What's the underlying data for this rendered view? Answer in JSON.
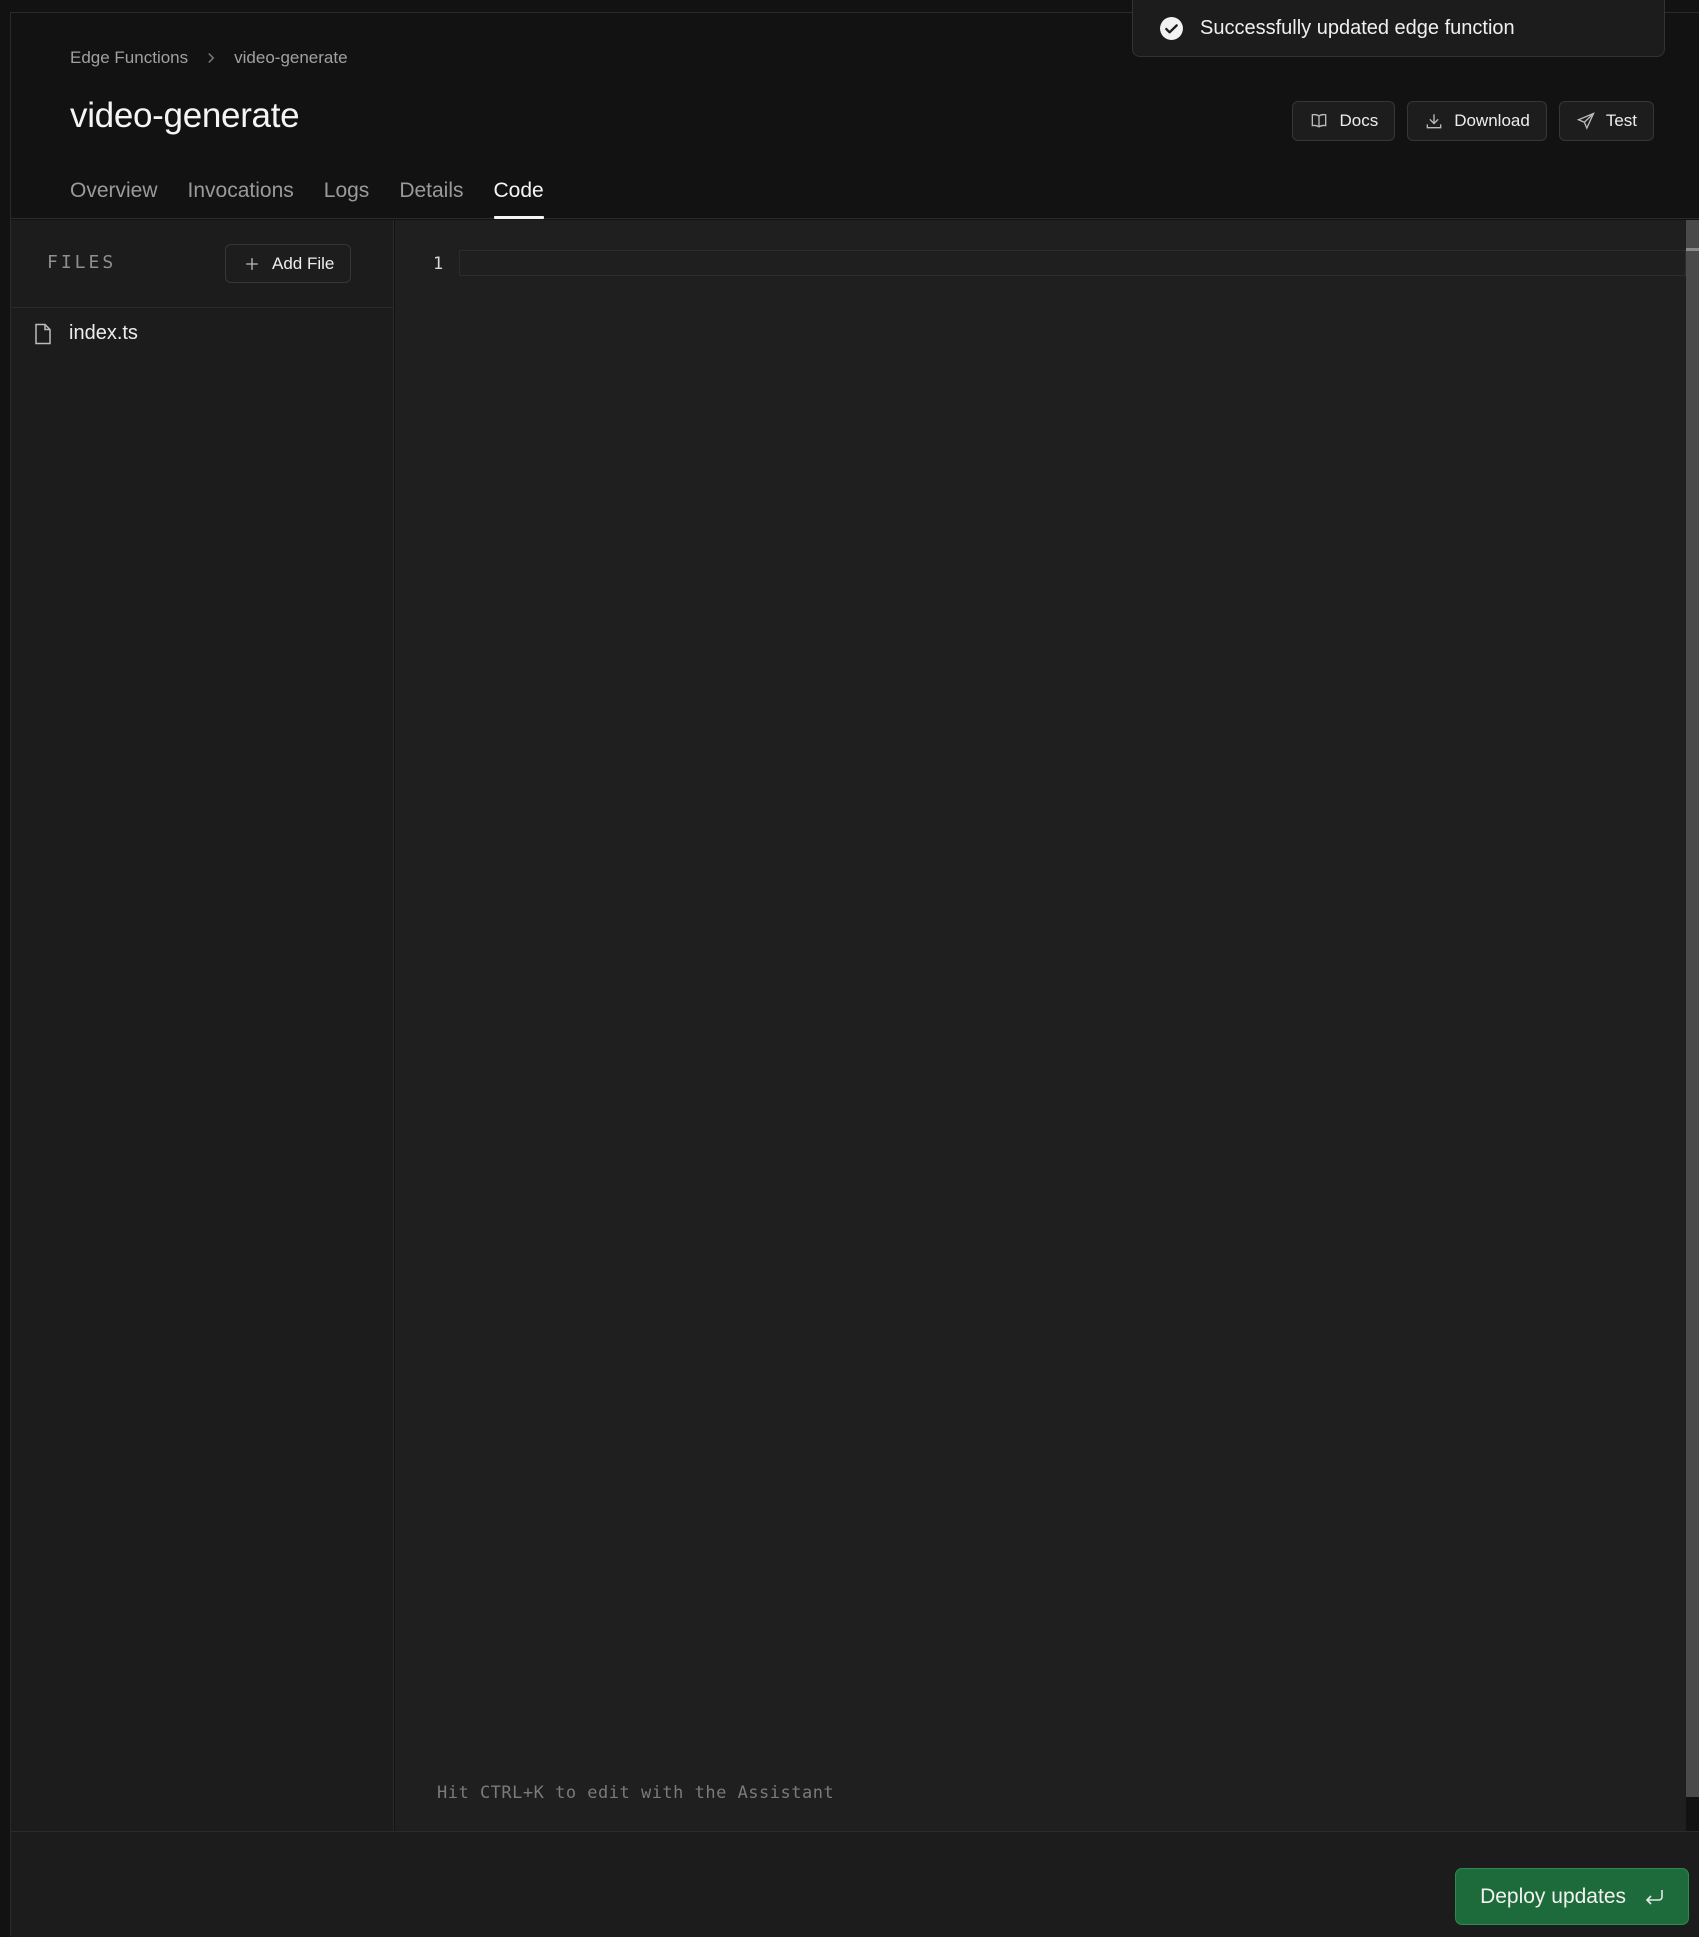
{
  "breadcrumb": {
    "root": "Edge Functions",
    "current": "video-generate"
  },
  "page": {
    "title": "video-generate"
  },
  "actions": {
    "docs": "Docs",
    "download": "Download",
    "test": "Test"
  },
  "tabs": [
    {
      "label": "Overview"
    },
    {
      "label": "Invocations"
    },
    {
      "label": "Logs"
    },
    {
      "label": "Details"
    },
    {
      "label": "Code",
      "active": true
    }
  ],
  "files": {
    "label": "FILES",
    "add_label": "Add File",
    "items": [
      {
        "name": "index.ts"
      }
    ]
  },
  "editor": {
    "line_numbers": [
      "1"
    ],
    "hint": "Hit CTRL+K to edit with the Assistant"
  },
  "footer": {
    "deploy_label": "Deploy updates"
  },
  "toast": {
    "message": "Successfully updated edge function"
  },
  "colors": {
    "accent": "#1d6b3a",
    "background": "#121212",
    "panel": "#1c1c1c",
    "editor": "#1f1f1f"
  }
}
